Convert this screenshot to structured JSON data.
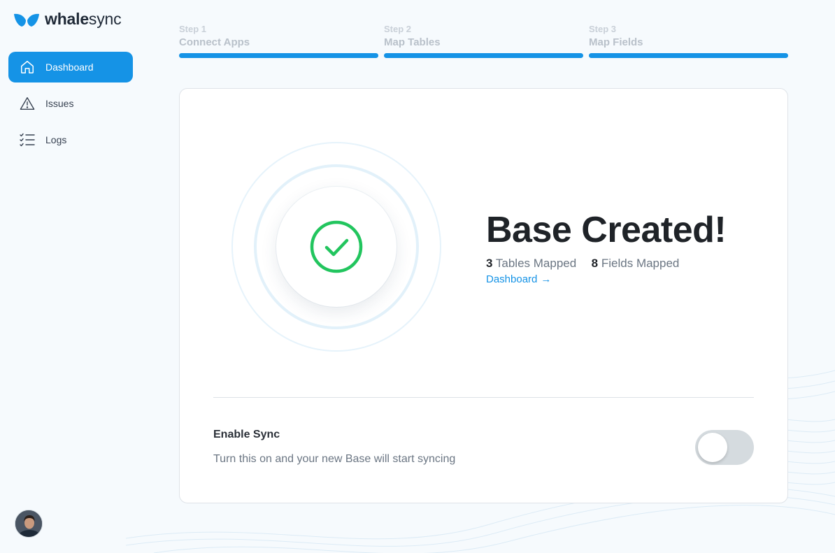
{
  "brand": {
    "name_bold": "whale",
    "name_light": "sync",
    "accent": "#1593e6"
  },
  "sidebar": {
    "items": [
      {
        "label": "Dashboard",
        "icon": "home-icon",
        "active": true
      },
      {
        "label": "Issues",
        "icon": "warning-icon",
        "active": false
      },
      {
        "label": "Logs",
        "icon": "checklist-icon",
        "active": false
      }
    ]
  },
  "steps": [
    {
      "num": "Step 1",
      "title": "Connect Apps",
      "progress": 1
    },
    {
      "num": "Step 2",
      "title": "Map Tables",
      "progress": 1
    },
    {
      "num": "Step 3",
      "title": "Map Fields",
      "progress": 1
    }
  ],
  "result": {
    "title": "Base Created!",
    "tables_count": "3",
    "tables_label": "Tables Mapped",
    "fields_count": "8",
    "fields_label": "Fields Mapped",
    "link_label": "Dashboard",
    "link_arrow": "→",
    "success_color": "#22c55e"
  },
  "sync": {
    "title": "Enable Sync",
    "description": "Turn this on and your new Base will start syncing",
    "enabled": false
  }
}
